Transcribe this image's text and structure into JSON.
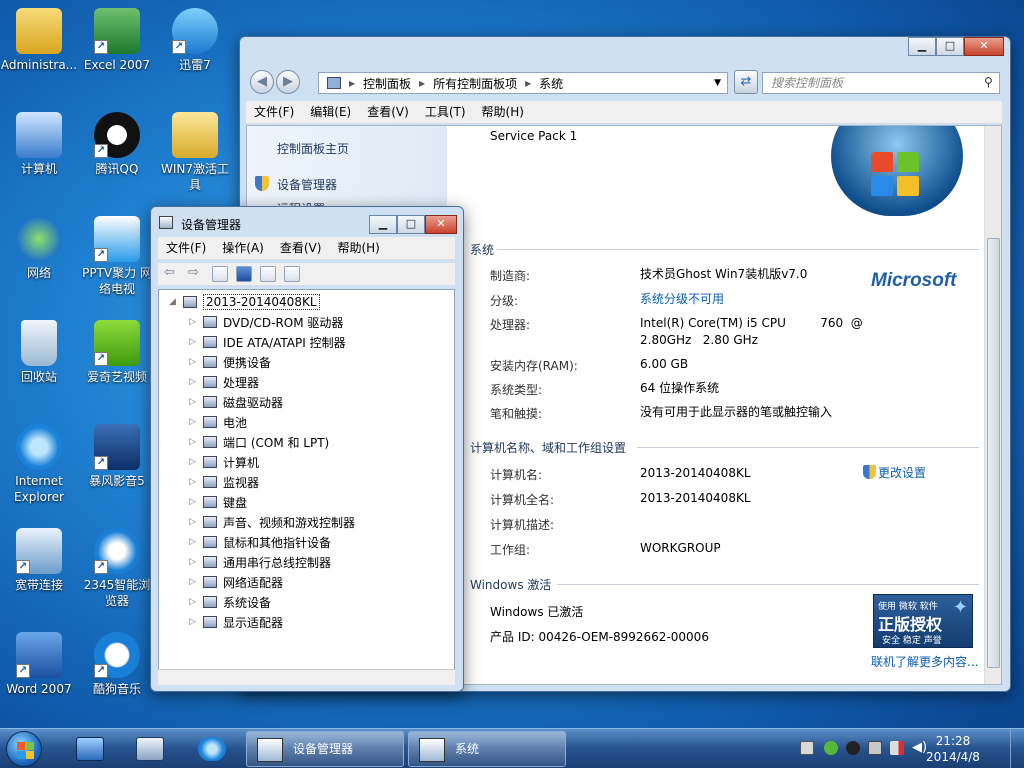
{
  "desktop": {
    "icons": [
      {
        "label": "Administra...",
        "name": "administrator"
      },
      {
        "label": "Excel 2007",
        "name": "excel"
      },
      {
        "label": "迅雷7",
        "name": "xunlei"
      },
      {
        "label": "计算机",
        "name": "computer"
      },
      {
        "label": "腾讯QQ",
        "name": "qq"
      },
      {
        "label": "WIN7激活工具",
        "name": "win7-activator"
      },
      {
        "label": "网络",
        "name": "network"
      },
      {
        "label": "PPTV聚力 网络电视",
        "name": "pptv"
      },
      {
        "label": "回收站",
        "name": "recycle-bin"
      },
      {
        "label": "爱奇艺视频",
        "name": "iqiyi"
      },
      {
        "label": "Internet Explorer",
        "name": "ie"
      },
      {
        "label": "暴风影音5",
        "name": "baofeng"
      },
      {
        "label": "宽带连接",
        "name": "broadband"
      },
      {
        "label": "2345智能浏览器",
        "name": "browser-2345"
      },
      {
        "label": "Word 2007",
        "name": "word"
      },
      {
        "label": "酷狗音乐",
        "name": "kugou"
      }
    ]
  },
  "system_window": {
    "breadcrumb": [
      "控制面板",
      "所有控制面板项",
      "系统"
    ],
    "search_placeholder": "搜索控制面板",
    "menu": [
      "文件(F)",
      "编辑(E)",
      "查看(V)",
      "工具(T)",
      "帮助(H)"
    ],
    "left_links": [
      "控制面板主页",
      "设备管理器",
      "远程设置"
    ],
    "service_pack": "Service Pack 1",
    "section_system": "系统",
    "manufacturer_label": "制造商:",
    "manufacturer": "技术员Ghost Win7装机版v7.0",
    "microsoft_logo": "Microsoft",
    "rating_label": "分级:",
    "rating": "系统分级不可用",
    "cpu_label": "处理器:",
    "cpu_line1": "Intel(R) Core(TM) i5 CPU         760  @",
    "cpu_line2": "2.80GHz   2.80 GHz",
    "ram_label": "安装内存(RAM):",
    "ram": "6.00 GB",
    "systype_label": "系统类型:",
    "systype": "64 位操作系统",
    "pen_label": "笔和触摸:",
    "pen": "没有可用于此显示器的笔或触控输入",
    "section_name": "计算机名称、域和工作组设置",
    "compname_label": "计算机名:",
    "compname": "2013-20140408KL",
    "fullname_label": "计算机全名:",
    "fullname": "2013-20140408KL",
    "desc_label": "计算机描述:",
    "workgroup_label": "工作组:",
    "workgroup": "WORKGROUP",
    "change_settings": "更改设置",
    "section_activation": "Windows 激活",
    "activated": "Windows 已激活",
    "product_id": "产品 ID: 00426-OEM-8992662-00006",
    "genuine_top": "使用 微软 软件",
    "genuine_main": "正版授权",
    "genuine_sub": "安全 稳定 声誉",
    "more_online": "联机了解更多内容..."
  },
  "device_manager": {
    "title": "设备管理器",
    "menu": [
      "文件(F)",
      "操作(A)",
      "查看(V)",
      "帮助(H)"
    ],
    "root": "2013-20140408KL",
    "items": [
      "DVD/CD-ROM 驱动器",
      "IDE ATA/ATAPI 控制器",
      "便携设备",
      "处理器",
      "磁盘驱动器",
      "电池",
      "端口 (COM 和 LPT)",
      "计算机",
      "监视器",
      "键盘",
      "声音、视频和游戏控制器",
      "鼠标和其他指针设备",
      "通用串行总线控制器",
      "网络适配器",
      "系统设备",
      "显示适配器"
    ]
  },
  "taskbar": {
    "buttons": [
      "设备管理器",
      "系统"
    ],
    "time": "21:28",
    "date": "2014/4/8"
  }
}
